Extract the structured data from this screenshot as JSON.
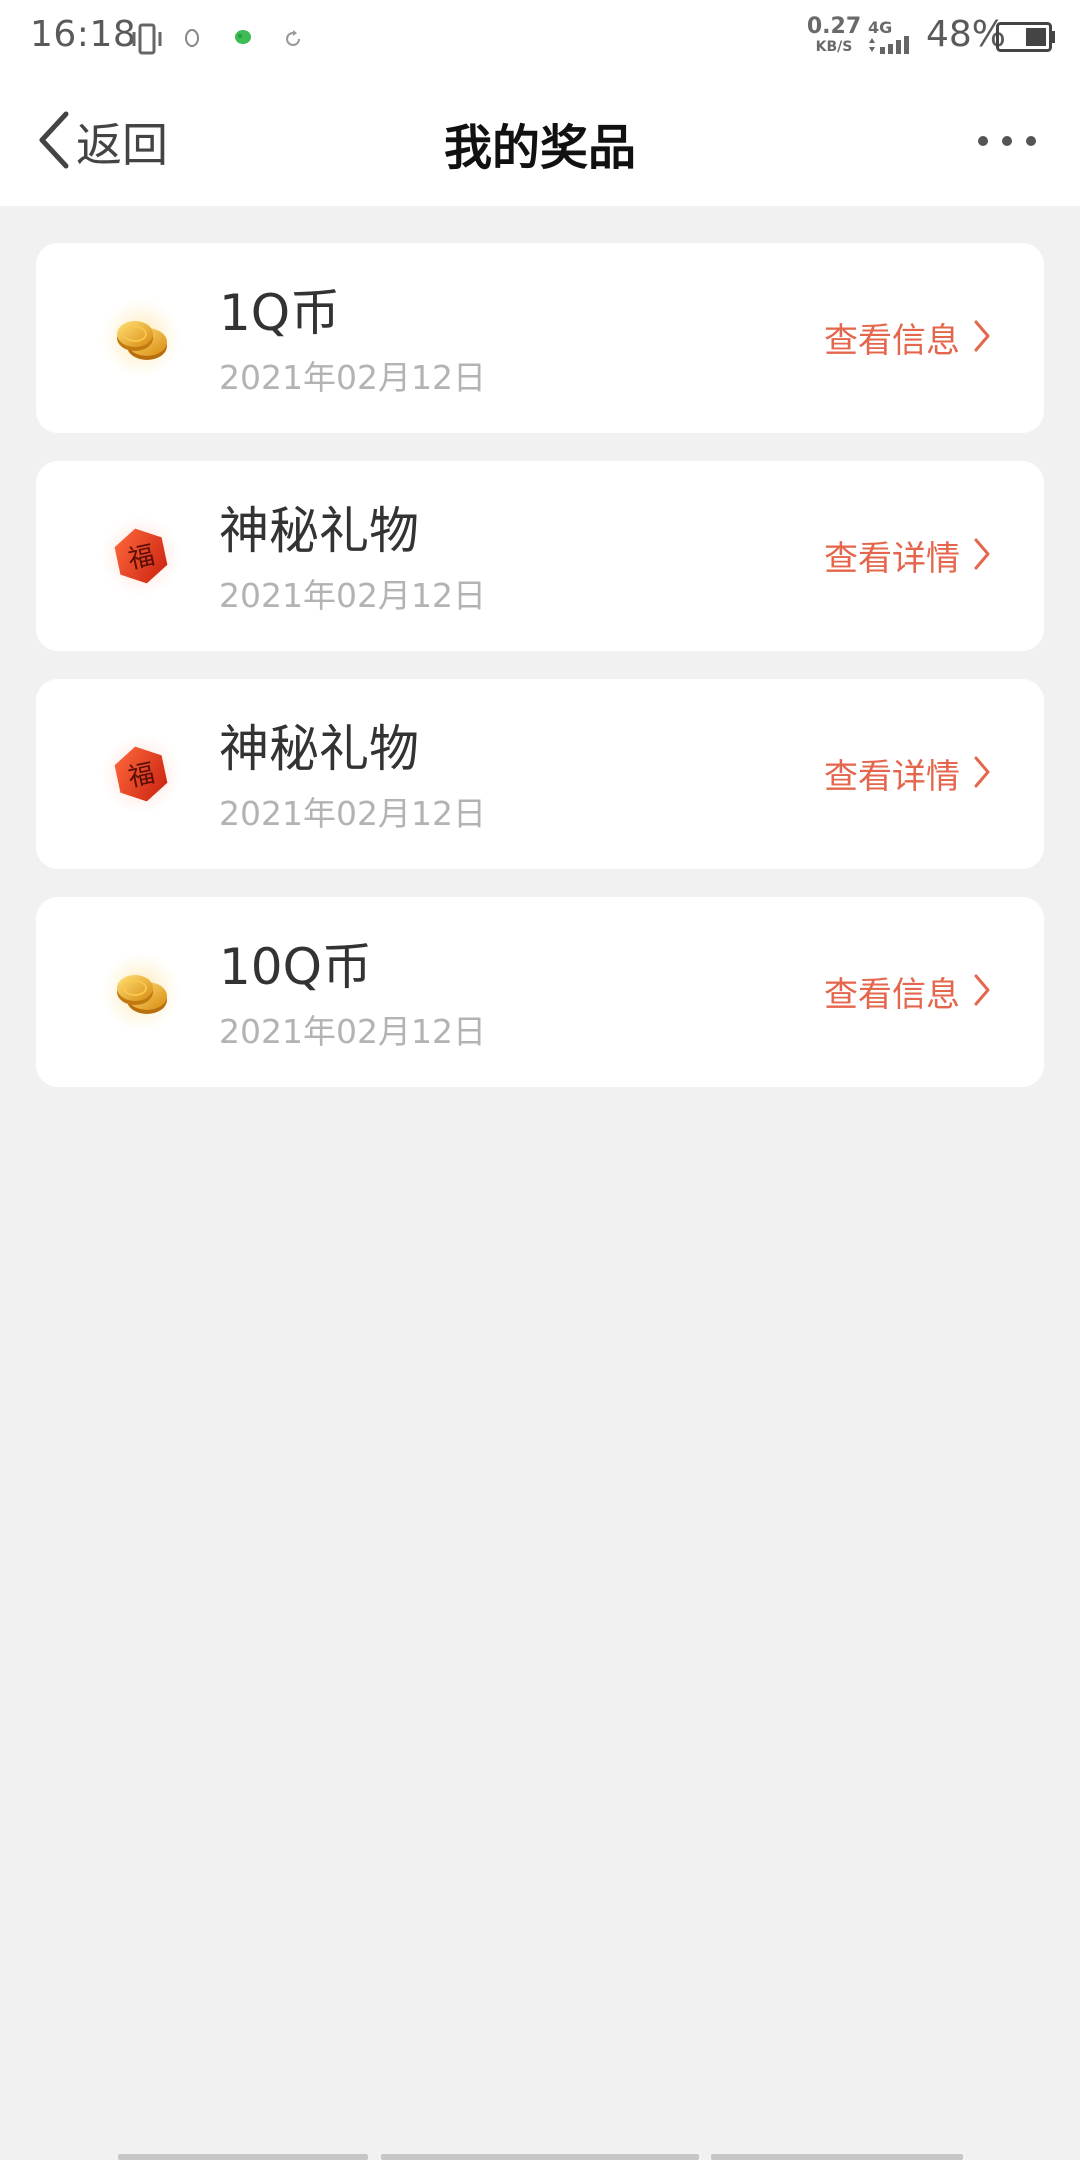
{
  "status_bar": {
    "time": "16:18",
    "speed_value": "0.27",
    "speed_unit": "KB/S",
    "network": "4G",
    "battery": "48%",
    "icons": [
      "vibrate-icon",
      "qq-icon",
      "wechat-icon",
      "sync-icon",
      "signal-icon",
      "battery-icon"
    ]
  },
  "header": {
    "back_label": "返回",
    "title": "我的奖品",
    "more_icon": "more-icon"
  },
  "prizes": [
    {
      "name": "1Q币",
      "date": "2021年02月12日",
      "action": "查看信息",
      "icon": "coin-icon"
    },
    {
      "name": "神秘礼物",
      "date": "2021年02月12日",
      "action": "查看详情",
      "icon": "fortune-icon"
    },
    {
      "name": "神秘礼物",
      "date": "2021年02月12日",
      "action": "查看详情",
      "icon": "fortune-icon"
    },
    {
      "name": "10Q币",
      "date": "2021年02月12日",
      "action": "查看信息",
      "icon": "coin-icon"
    }
  ],
  "colors": {
    "accent": "#e4664c",
    "background": "#f1f1f1",
    "card": "#ffffff",
    "date_text": "#b3b3b3"
  }
}
